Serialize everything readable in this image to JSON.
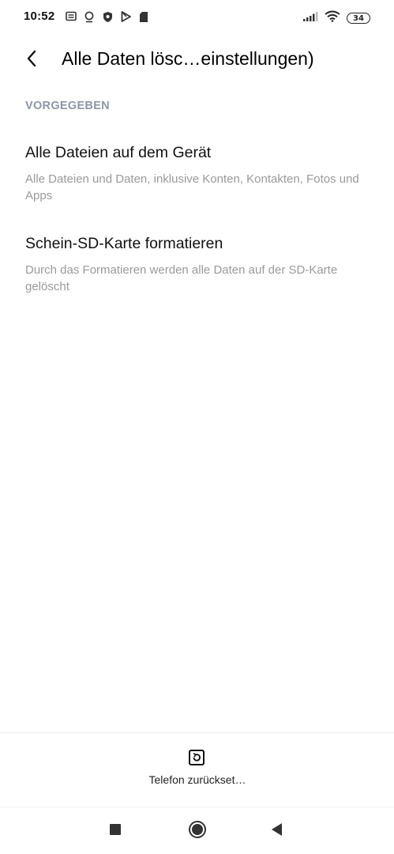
{
  "status_bar": {
    "time": "10:52",
    "left_icons": [
      "message-icon",
      "location-pin-icon",
      "shield-icon",
      "play-store-icon",
      "sd-card-icon"
    ],
    "right_icons": [
      "signal-icon",
      "wifi-icon"
    ],
    "battery": "34"
  },
  "header": {
    "title": "Alle Daten lösc…einstellungen)",
    "back_icon": "chevron-left-icon"
  },
  "section": {
    "label": "VORGEGEBEN"
  },
  "items": [
    {
      "title": "Alle Dateien auf dem Gerät",
      "description": "Alle Dateien und Daten, inklusive Konten, Kontakten, Fotos und Apps"
    },
    {
      "title": "Schein-SD-Karte formatieren",
      "description": "Durch das Formatieren werden alle Daten auf der SD-Karte gelöscht"
    }
  ],
  "bottom_action": {
    "label": "Telefon zurückset…",
    "icon": "reset-icon"
  },
  "nav_bar": {
    "recent_icon": "square-icon",
    "home_icon": "circle-icon",
    "back_icon": "triangle-back-icon"
  },
  "colors": {
    "section_header": "#8e95a6",
    "description": "#9a9a9a",
    "background": "#ffffff"
  }
}
